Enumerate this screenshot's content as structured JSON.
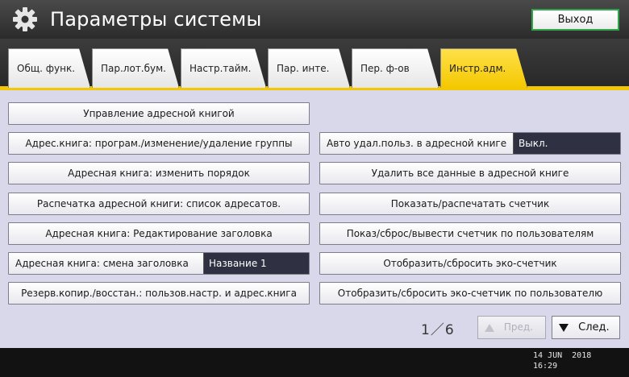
{
  "header": {
    "title": "Параметры системы",
    "exit_label": "Выход",
    "icon": "gear-icon"
  },
  "tabs": [
    {
      "label": "Общ. функ.",
      "active": false
    },
    {
      "label": "Пар.лот.бум.",
      "active": false
    },
    {
      "label": "Настр.тайм.",
      "active": false
    },
    {
      "label": "Пар. инте.",
      "active": false
    },
    {
      "label": "Пер. ф-ов",
      "active": false
    },
    {
      "label": "Инстр.адм.",
      "active": true
    }
  ],
  "left_buttons": [
    {
      "label": "Управление адресной книгой"
    },
    {
      "label": "Адрес.книга: програм./изменение/удаление группы"
    },
    {
      "label": "Адресная книга: изменить порядок"
    },
    {
      "label": "Распечатка адресной книги: список адресатов."
    },
    {
      "label": "Адресная книга: Редактирование заголовка"
    },
    {
      "label": "Адресная книга: смена заголовка",
      "value": "Название 1"
    },
    {
      "label": "Резерв.копир./восстан.: пользов.настр. и адрес.книга"
    }
  ],
  "right_buttons": [
    {
      "label": "Авто удал.польз. в адресной книге",
      "value": "Выкл."
    },
    {
      "label": "Удалить все данные в адресной книге"
    },
    {
      "label": "Показать/распечатать счетчик"
    },
    {
      "label": "Показ/сброс/вывести счетчик по пользователям"
    },
    {
      "label": "Отобразить/сбросить эко-счетчик"
    },
    {
      "label": "Отобразить/сбросить эко-счетчик по пользователю"
    }
  ],
  "pager": {
    "text": "1／6",
    "prev_label": "Пред.",
    "next_label": "След."
  },
  "footer": {
    "date": "14 JUN  2018",
    "time": "16:29"
  },
  "colors": {
    "accent": "#f4c800",
    "exit_border": "#2fa64a",
    "background": "#d9d8ea",
    "value_box": "#2f3142"
  }
}
